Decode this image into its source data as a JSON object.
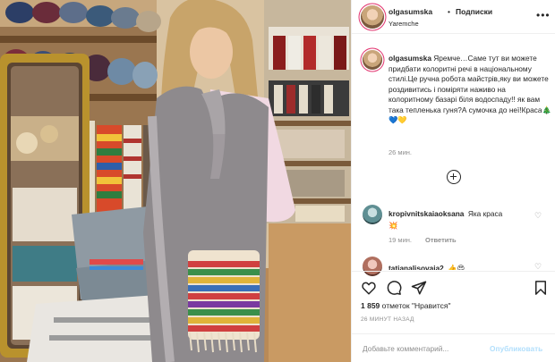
{
  "post": {
    "username": "olgasumska",
    "dot": "•",
    "follow_label": "Подписки",
    "location": "Yaremche",
    "more_glyph": "•••"
  },
  "caption": {
    "username": "olgasumska",
    "text": "Яремче…Саме тут ви можете придбати колоритні речі в національному стилі.Це ручна робота майстрів,яку ви можете роздивитись і поміряти наживо на колоритному базарі біля водоспаду!! як вам така тепленька гуня?А сумочка до неї!Краса",
    "emojis": [
      "🎄",
      "💙",
      "💛"
    ],
    "time": "26 мин."
  },
  "comments": [
    {
      "username": "kropivnitskaiaoksana",
      "text": "Яка краса",
      "emoji": "💥",
      "time": "19 мин.",
      "reply_label": "Ответить"
    },
    {
      "username": "tatianalisovaia2",
      "text": "",
      "emoji": "👍😍",
      "time": "",
      "reply_label": ""
    }
  ],
  "stats": {
    "likes_count": "1 859",
    "likes_text": "отметок \"Нравится\"",
    "posted": "26 МИНУТ НАЗАД"
  },
  "comment_form": {
    "placeholder": "Добавьте комментарий...",
    "publish_label": "Опубликовать"
  },
  "colors": {
    "text": "#262626",
    "muted": "#8e8e8e",
    "publish_disabled": "#b2dffc",
    "border": "#efefef",
    "story_ring": "#e1306c"
  },
  "icons": [
    "plus-circle-icon",
    "heart-icon",
    "comment-icon",
    "share-icon",
    "bookmark-icon",
    "more-icon"
  ]
}
